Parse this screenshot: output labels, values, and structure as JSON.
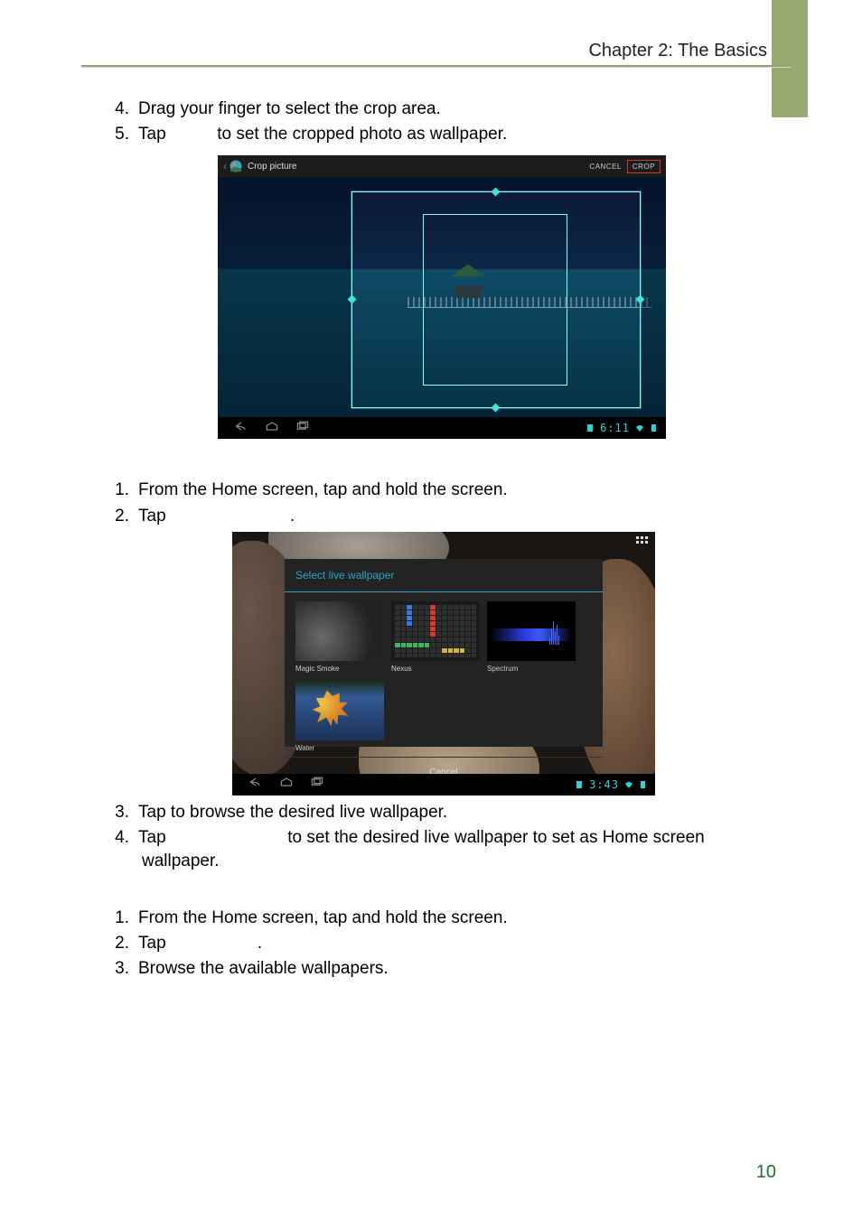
{
  "chapter_title": "Chapter 2: The Basics",
  "page_number": "10",
  "section_a": {
    "items": [
      {
        "num": "4.",
        "text": "Drag your finger to select the crop area."
      },
      {
        "num": "5.",
        "text_before": "Tap ",
        "text_after": " to set the cropped photo as wallpaper."
      }
    ]
  },
  "screenshot1": {
    "title": "Crop picture",
    "cancel": "CANCEL",
    "crop": "CROP",
    "clock": "6:11"
  },
  "section_b": {
    "items": [
      {
        "num": "1.",
        "text": "From the Home screen, tap and hold the screen."
      },
      {
        "num": "2.",
        "text_before": "Tap ",
        "text_after": "."
      }
    ]
  },
  "screenshot2": {
    "dialog_title": "Select live wallpaper",
    "wallpapers": [
      {
        "label": "Magic Smoke"
      },
      {
        "label": "Nexus"
      },
      {
        "label": "Spectrum"
      },
      {
        "label": "Water"
      }
    ],
    "cancel": "Cancel",
    "clock": "3:43"
  },
  "section_c": {
    "items": [
      {
        "num": "3.",
        "text": "Tap to browse the desired live wallpaper."
      },
      {
        "num": "4.",
        "text_before": "Tap ",
        "text_after": " to set the desired live wallpaper to set as Home screen wallpaper."
      }
    ]
  },
  "section_d": {
    "items": [
      {
        "num": "1.",
        "text": "From the Home screen, tap and hold the screen."
      },
      {
        "num": "2.",
        "text_before": "Tap ",
        "text_after": "."
      },
      {
        "num": "3.",
        "text": "Browse the available wallpapers."
      }
    ]
  }
}
